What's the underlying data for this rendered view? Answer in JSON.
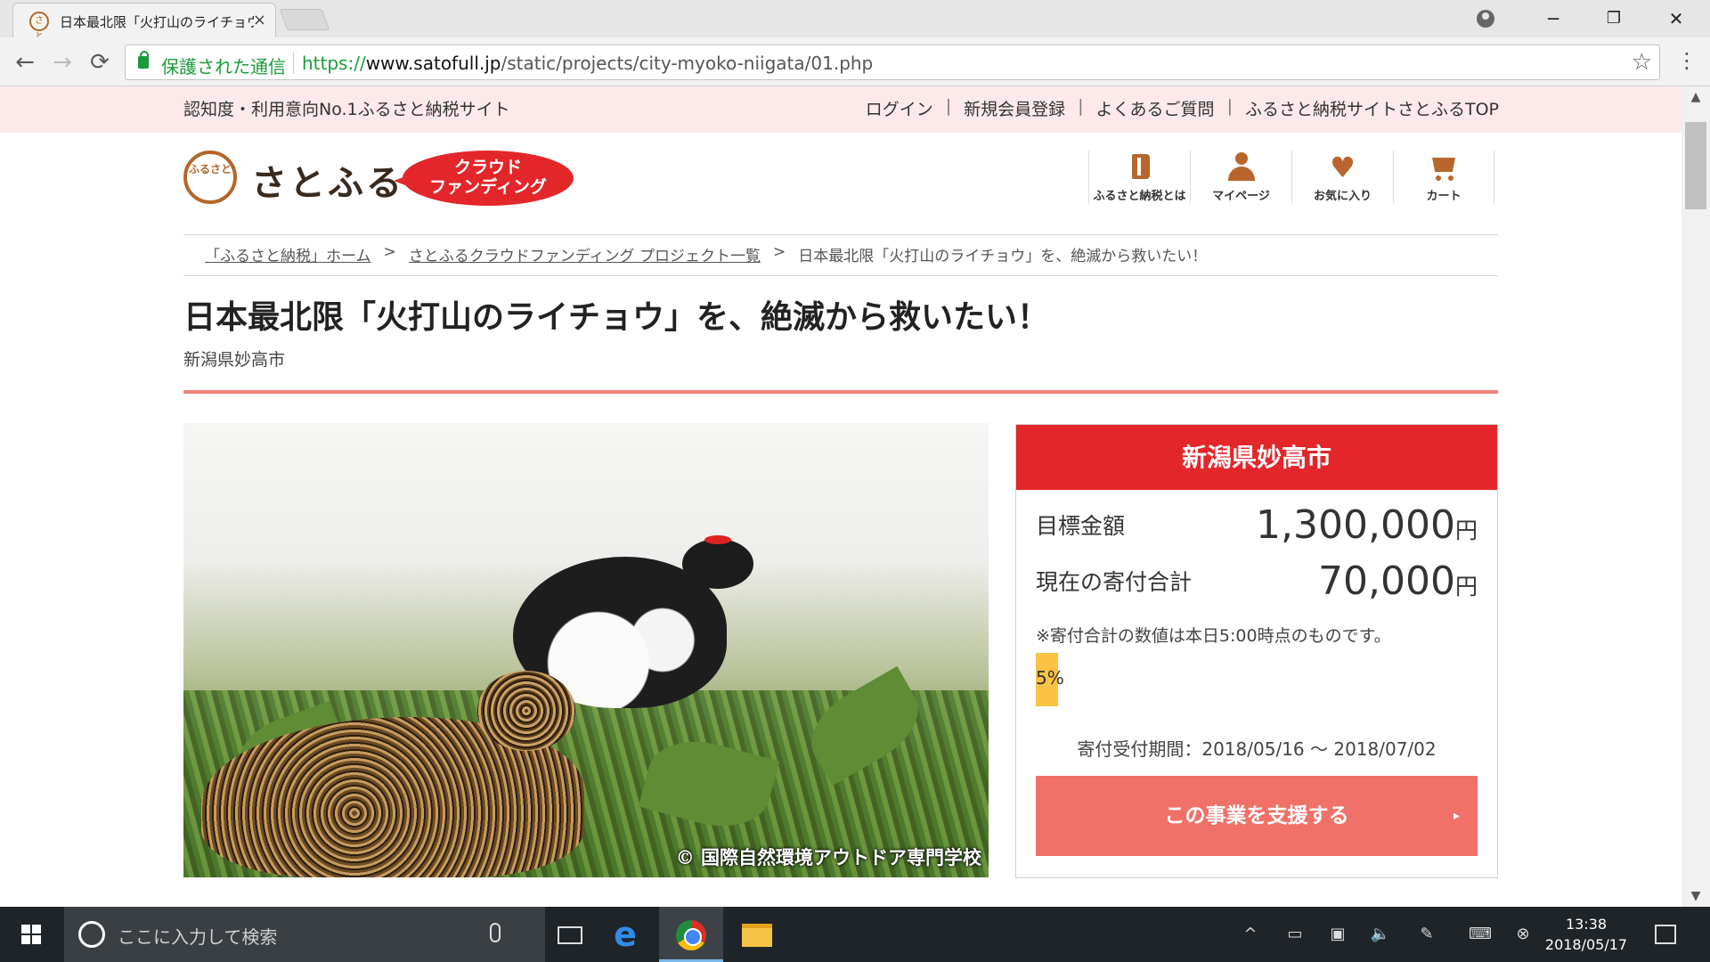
{
  "browser": {
    "tab_title": "日本最北限「火打山のライチョウ」を、絶滅から救いたい！",
    "tab_close": "×",
    "favicon_text": "さと",
    "secure_label": "保護された通信",
    "url_scheme": "https://",
    "url_host": "www.satofull.jp",
    "url_path": "/static/projects/city-myoko-niigata/01.php",
    "back_glyph": "←",
    "forward_glyph": "→",
    "reload_glyph": "⟳",
    "star_glyph": "☆",
    "menu_glyph": "⋮",
    "min_glyph": "─",
    "restore_glyph": "❐",
    "close_glyph": "✕"
  },
  "site": {
    "tagline": "認知度・利用意向No.1ふるさと納税サイト",
    "top_links": [
      "ログイン",
      "新規会員登録",
      "よくあるご質問",
      "ふるさと納税サイトさとふるTOP"
    ],
    "link_separator": "|",
    "logo_mark": "ふるさと",
    "logo_text": "さとふる",
    "badge_line1": "クラウド",
    "badge_line2": "ファンディング",
    "icon_nav": [
      {
        "label": "ふるさと納税とは",
        "icon": "book-icon"
      },
      {
        "label": "マイページ",
        "icon": "person-icon"
      },
      {
        "label": "お気に入り",
        "icon": "heart-icon"
      },
      {
        "label": "カート",
        "icon": "cart-icon"
      }
    ],
    "heart_glyph": "♥"
  },
  "breadcrumb": {
    "home": "「ふるさと納税」ホーム",
    "list": "さとふるクラウドファンディング プロジェクト一覧",
    "current": "日本最北限「火打山のライチョウ」を、絶滅から救いたい！",
    "separator": ">"
  },
  "project": {
    "title": "日本最北限「火打山のライチョウ」を、絶滅から救いたい！",
    "municipality": "新潟県妙高市",
    "photo_credit": "© 国際自然環境アウトドア専門学校"
  },
  "panel": {
    "header": "新潟県妙高市",
    "goal_label": "目標金額",
    "goal_value": "1,300,000",
    "total_label": "現在の寄付合計",
    "total_value": "70,000",
    "unit": "円",
    "note": "※寄付合計の数値は本日5:00時点のものです。",
    "progress_label": "5%",
    "progress_fraction": 0.05,
    "period": "寄付受付期間：2018/05/16 ～ 2018/07/02",
    "support_button": "この事業を支援する",
    "support_arrow": "▸",
    "accent_color": "#e3262a",
    "button_color": "#f07168",
    "progress_color": "#fbc244"
  },
  "scrollbar": {
    "up": "▲",
    "down": "▼"
  },
  "taskbar": {
    "search_placeholder": "ここに入力して検索",
    "edge_glyph": "e",
    "tray_chevron": "^",
    "time": "13:38",
    "date": "2018/05/17"
  }
}
